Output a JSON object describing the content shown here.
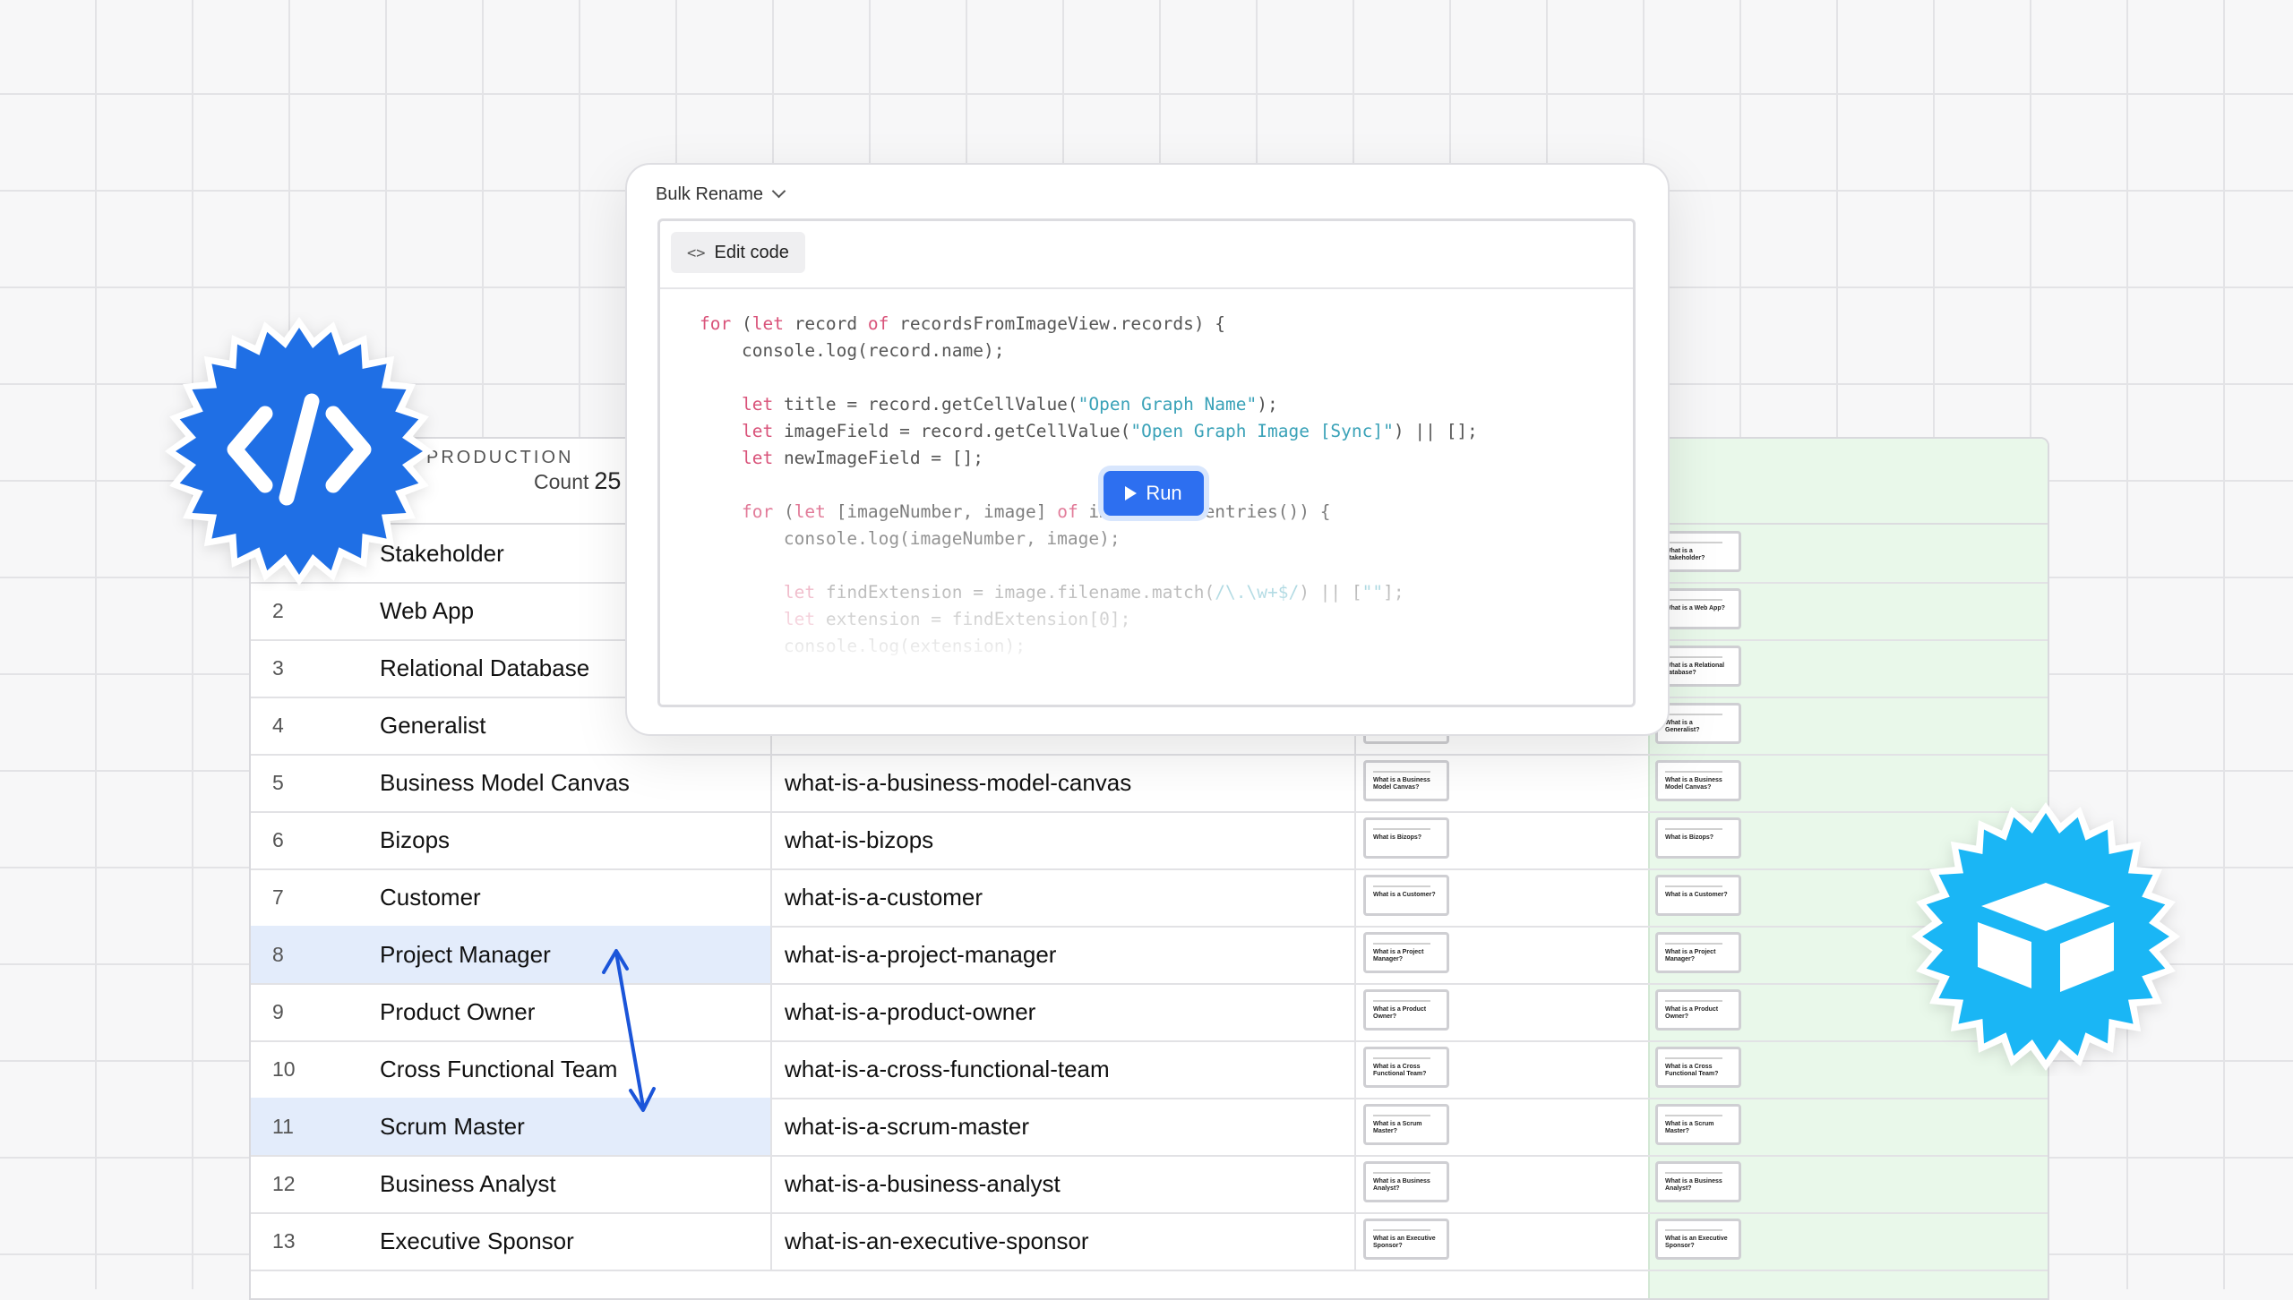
{
  "table": {
    "group_label": "PRODUCTION",
    "count_label": "Count",
    "count_value": "25",
    "rows": [
      {
        "num": "",
        "name": "Stakeholder",
        "slug": "",
        "thumb": "What is a Stakeholder?",
        "selected": false
      },
      {
        "num": "2",
        "name": "Web App",
        "slug": "",
        "thumb": "What is a Web App?",
        "selected": false
      },
      {
        "num": "3",
        "name": "Relational Database",
        "slug": "",
        "thumb": "What is a Relational database?",
        "selected": false
      },
      {
        "num": "4",
        "name": "Generalist",
        "slug": "",
        "thumb": "What is a Generalist?",
        "selected": false
      },
      {
        "num": "5",
        "name": "Business Model Canvas",
        "slug": "what-is-a-business-model-canvas",
        "thumb": "What is a Business Model Canvas?",
        "selected": false
      },
      {
        "num": "6",
        "name": "Bizops",
        "slug": "what-is-bizops",
        "thumb": "What is Bizops?",
        "selected": false
      },
      {
        "num": "7",
        "name": "Customer",
        "slug": "what-is-a-customer",
        "thumb": "What is a Customer?",
        "selected": false
      },
      {
        "num": "8",
        "name": "Project Manager",
        "slug": "what-is-a-project-manager",
        "thumb": "What is a Project Manager?",
        "selected": true
      },
      {
        "num": "9",
        "name": "Product Owner",
        "slug": "what-is-a-product-owner",
        "thumb": "What is a Product Owner?",
        "selected": false
      },
      {
        "num": "10",
        "name": "Cross Functional Team",
        "slug": "what-is-a-cross-functional-team",
        "thumb": "What is a Cross Functional Team?",
        "selected": false
      },
      {
        "num": "11",
        "name": "Scrum Master",
        "slug": "what-is-a-scrum-master",
        "thumb": "What is a Scrum Master?",
        "selected": true
      },
      {
        "num": "12",
        "name": "Business Analyst",
        "slug": "what-is-a-business-analyst",
        "thumb": "What is a Business Analyst?",
        "selected": false
      },
      {
        "num": "13",
        "name": "Executive Sponsor",
        "slug": "what-is-an-executive-sponsor",
        "thumb": "What is an Executive Sponsor?",
        "selected": false
      }
    ]
  },
  "modal": {
    "title": "Bulk Rename",
    "edit_code_label": "Edit code",
    "run_label": "Run",
    "code_lines": [
      [
        [
          "k",
          "for"
        ],
        [
          "p",
          " ("
        ],
        [
          "k",
          "let"
        ],
        [
          "p",
          " record "
        ],
        [
          "k",
          "of"
        ],
        [
          "p",
          " recordsFromImageView.records) {"
        ]
      ],
      [
        [
          "p",
          "    console.log(record.name);"
        ]
      ],
      [
        [
          "p",
          ""
        ]
      ],
      [
        [
          "p",
          "    "
        ],
        [
          "k",
          "let"
        ],
        [
          "p",
          " title = record.getCellValue("
        ],
        [
          "s",
          "\"Open Graph Name\""
        ],
        [
          "p",
          ");"
        ]
      ],
      [
        [
          "p",
          "    "
        ],
        [
          "k",
          "let"
        ],
        [
          "p",
          " imageField = record.getCellValue("
        ],
        [
          "s",
          "\"Open Graph Image [Sync]\""
        ],
        [
          "p",
          ") || [];"
        ]
      ],
      [
        [
          "p",
          "    "
        ],
        [
          "k",
          "let"
        ],
        [
          "p",
          " newImageField = [];"
        ]
      ],
      [
        [
          "p",
          ""
        ]
      ],
      [
        [
          "p",
          "    "
        ],
        [
          "k",
          "for"
        ],
        [
          "p",
          " ("
        ],
        [
          "k",
          "let"
        ],
        [
          "p",
          " [imageNumber, image] "
        ],
        [
          "k",
          "of"
        ],
        [
          "p",
          " imageField.entries()) {"
        ]
      ],
      [
        [
          "p",
          "        console.log(imageNumber, image);"
        ]
      ],
      [
        [
          "p",
          ""
        ]
      ],
      [
        [
          "p",
          "        "
        ],
        [
          "k",
          "let"
        ],
        [
          "p",
          " findExtension = image.filename.match("
        ],
        [
          "s",
          "/\\.\\w+$/"
        ],
        [
          "p",
          ") || ["
        ],
        [
          "s",
          "\"\""
        ],
        [
          "p",
          "];"
        ]
      ],
      [
        [
          "p",
          "        "
        ],
        [
          "k",
          "let"
        ],
        [
          "p",
          " extension = findExtension[0];"
        ]
      ],
      [
        [
          "p",
          "        console.log(extension);"
        ]
      ]
    ]
  },
  "badges": {
    "left_icon": "code-icon",
    "left_color": "#1f6fe5",
    "right_icon": "airtable-cube-icon",
    "right_color": "#1ab6f5"
  },
  "colors": {
    "accent": "#2d6ff0",
    "selected_row": "#e3ecfb",
    "green_column": "#e9f8ea"
  }
}
